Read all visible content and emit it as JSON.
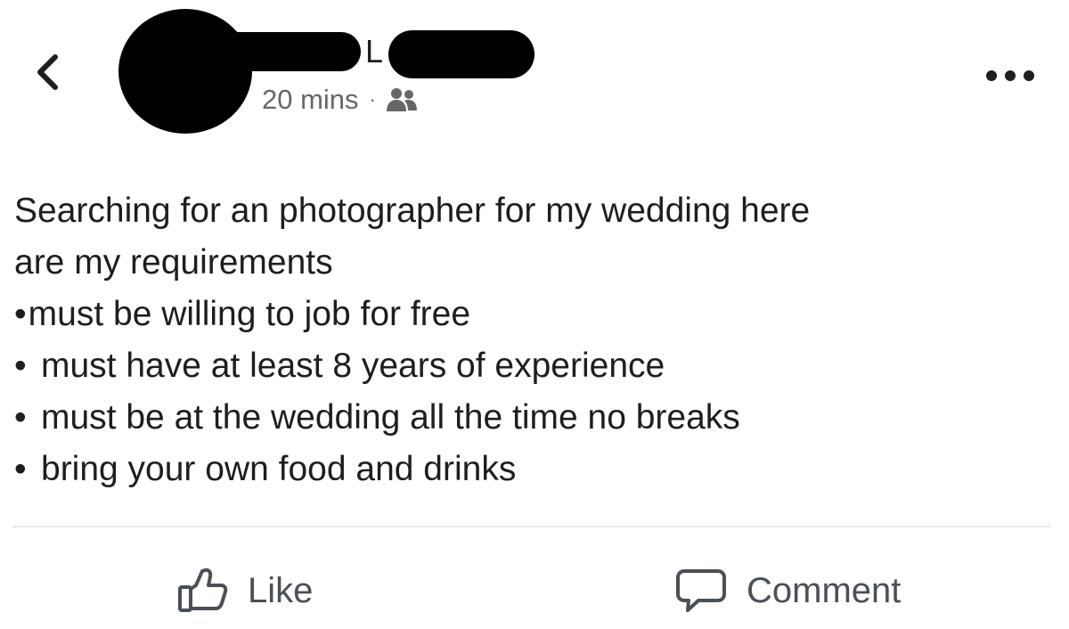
{
  "header": {
    "author_visible": "L",
    "time": "20 mins",
    "separator": "·",
    "audience_icon": "friends-icon",
    "back_icon": "chevron-left-icon",
    "more_icon": "more-dots-icon"
  },
  "post": {
    "lines": [
      "Searching for an photographer for my wedding here",
      "are my requirements",
      "must be willing to job for free",
      "must have at least 8 years of experience",
      "must be at the wedding all the time no breaks",
      "bring your own food and drinks"
    ]
  },
  "actions": {
    "like_label": "Like",
    "like_icon": "thumbs-up-icon",
    "comment_label": "Comment",
    "comment_icon": "comment-bubble-icon"
  },
  "colors": {
    "text": "#1c1e21",
    "meta": "#65676b",
    "action": "#4b4f56",
    "divider": "#e6e8ec"
  }
}
